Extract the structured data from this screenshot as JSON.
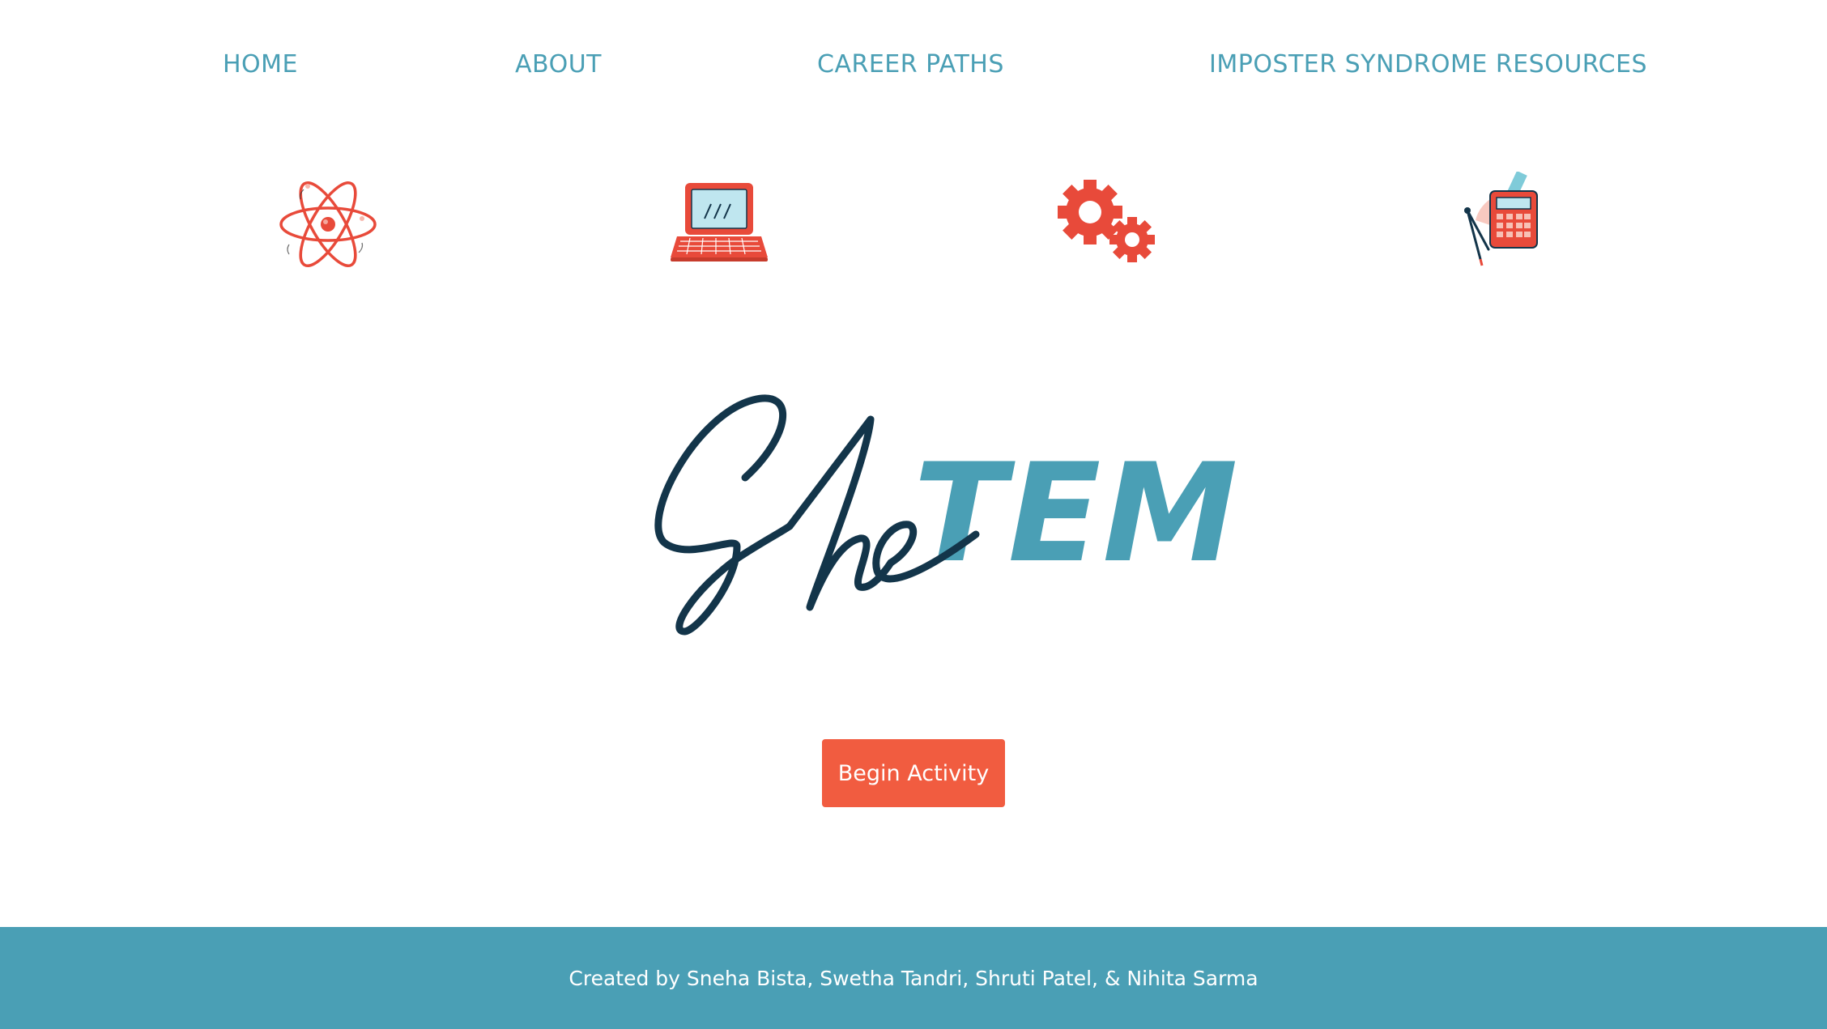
{
  "nav": {
    "items": [
      {
        "label": "HOME"
      },
      {
        "label": "ABOUT"
      },
      {
        "label": "CAREER PATHS"
      },
      {
        "label": "IMPOSTER SYNDROME RESOURCES"
      }
    ]
  },
  "icons": [
    "atom-icon",
    "laptop-icon",
    "gears-icon",
    "calculator-icon"
  ],
  "logo": {
    "script_part": "She",
    "bold_part": "TEM"
  },
  "cta": {
    "label": "Begin Activity"
  },
  "footer": {
    "credits": "Created by Sneha Bista, Swetha Tandri, Shruti Patel, & Nihita Sarma"
  },
  "colors": {
    "accent": "#4a9fb5",
    "button": "#f15c40",
    "navy": "#13354a",
    "icon_red": "#e84a3a",
    "background": "#ffffff"
  }
}
